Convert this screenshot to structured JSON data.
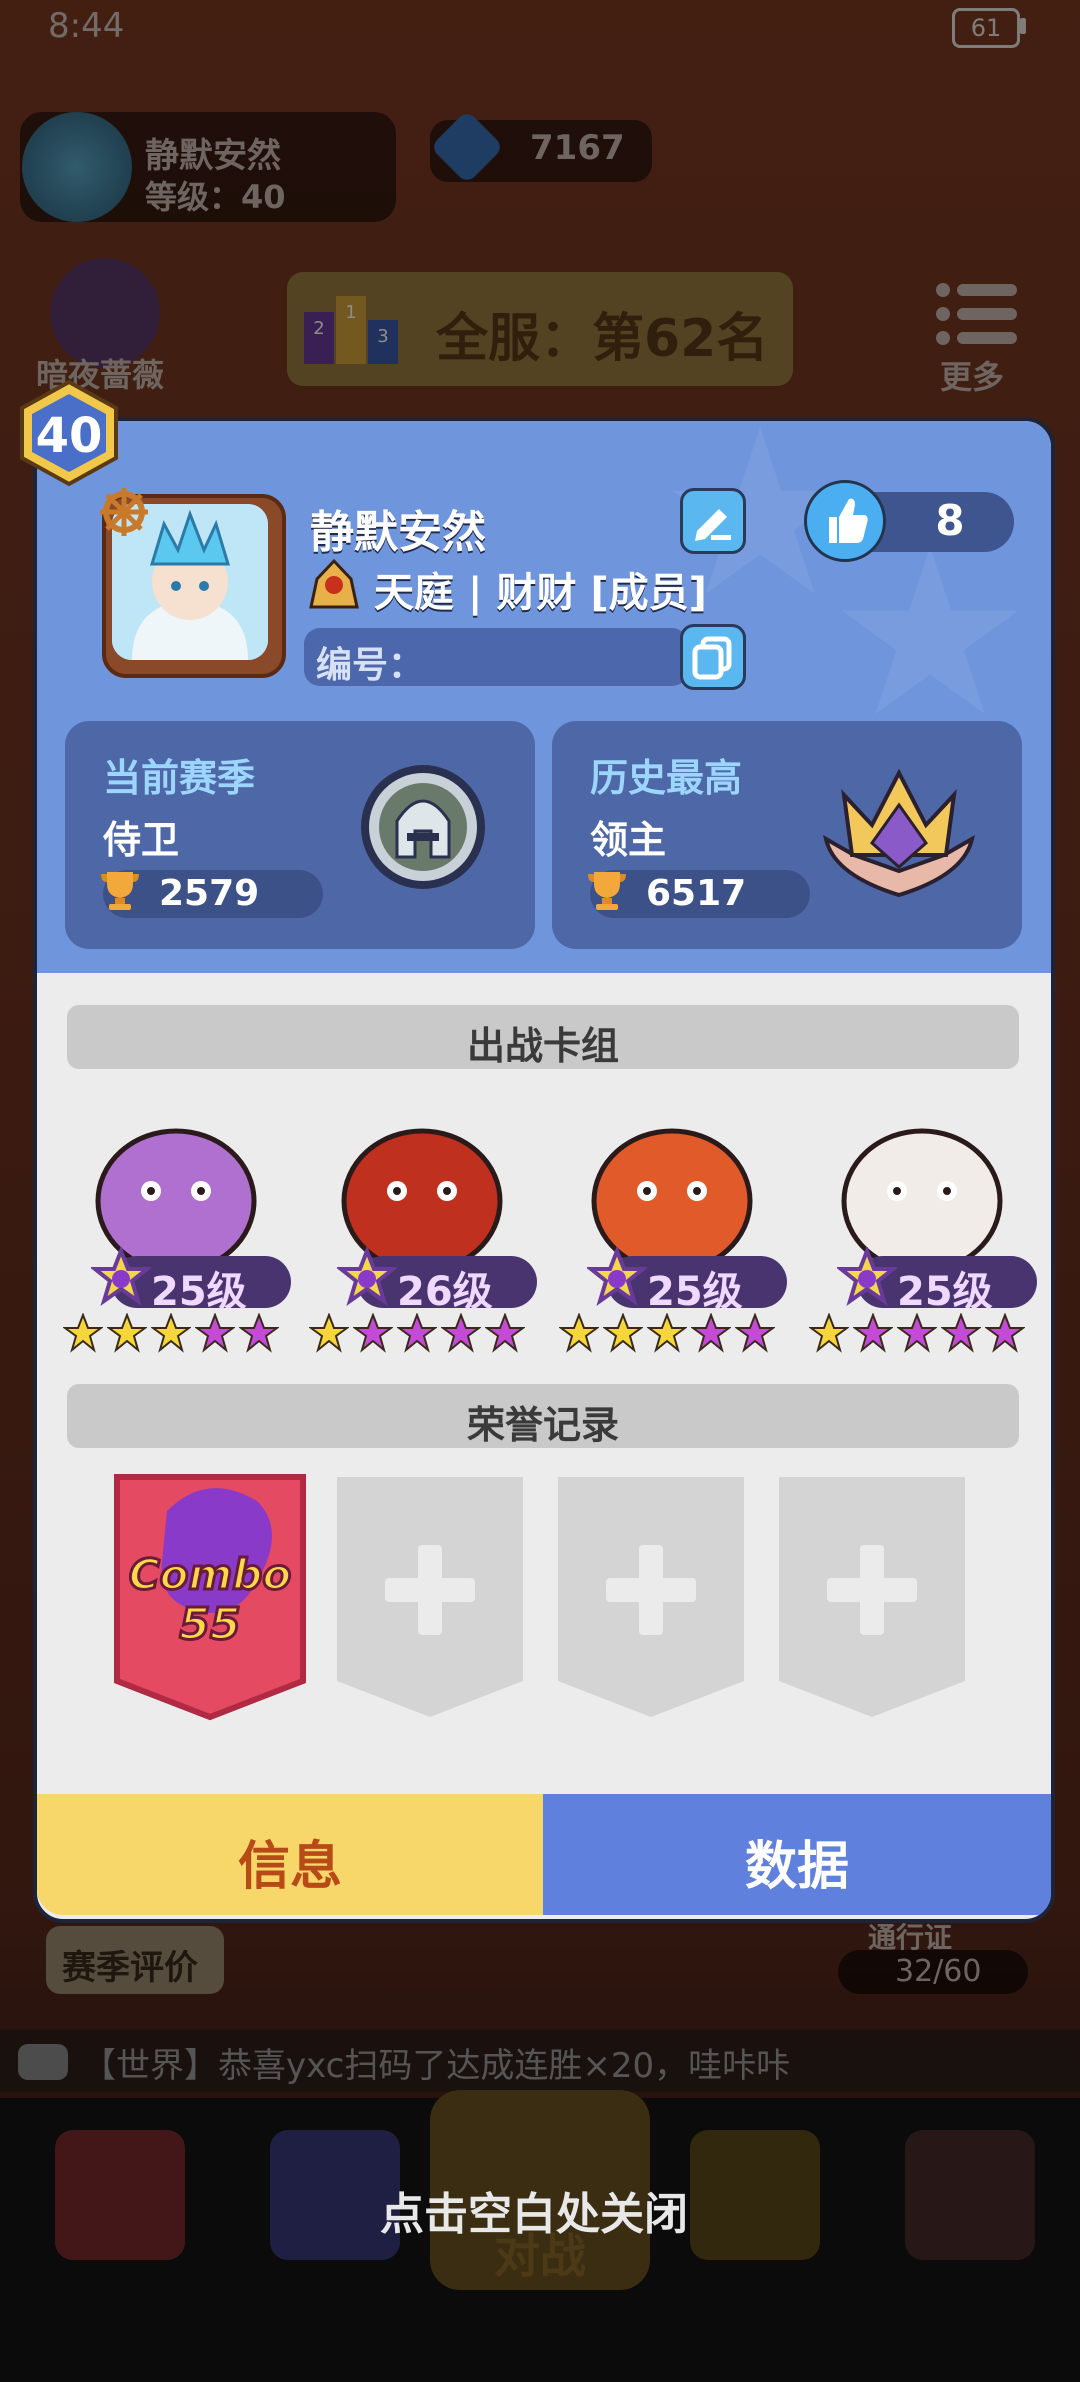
{
  "status": {
    "time": "8:44",
    "battery": "61"
  },
  "background": {
    "player_name": "静默安然",
    "player_level": "等级：40",
    "gems": "7167",
    "rank": "全服：第62名",
    "podium_labels": [
      "2",
      "1",
      "3"
    ],
    "hero_label": "暗夜蔷薇",
    "more_label": "更多",
    "season_label": "赛季评价",
    "pass_label": "通行证",
    "pass_value": "32/60",
    "chat_text": "【世界】恭喜yxc扫码了达成连胜×20，哇咔咔",
    "battle_label": "对战",
    "close_hint": "点击空白处关闭"
  },
  "profile": {
    "level": "40",
    "name": "静默安然",
    "guild": "天庭 | 财财 [成员]",
    "id_label": "编号：",
    "likes": "8"
  },
  "season": {
    "current": {
      "title": "当前赛季",
      "rank": "侍卫",
      "trophies": "2579"
    },
    "best": {
      "title": "历史最高",
      "rank": "领主",
      "trophies": "6517"
    }
  },
  "deck": {
    "title": "出战卡组",
    "cards": [
      {
        "level": "25级",
        "gold_stars": 3,
        "purple_stars": 2,
        "color": "#b070d0"
      },
      {
        "level": "26级",
        "gold_stars": 1,
        "purple_stars": 4,
        "color": "#c0301e"
      },
      {
        "level": "25级",
        "gold_stars": 3,
        "purple_stars": 2,
        "color": "#e05a2a"
      },
      {
        "level": "25级",
        "gold_stars": 1,
        "purple_stars": 4,
        "color": "#f2ece8"
      }
    ]
  },
  "honor": {
    "title": "荣誉记录",
    "badge_line1": "Combo",
    "badge_line2": "55"
  },
  "tabs": {
    "info": "信息",
    "data": "数据"
  },
  "colors": {
    "header_blue": "#6f95dc",
    "tab_gold": "#f7d76a",
    "tab_blue": "#5f80dc"
  }
}
